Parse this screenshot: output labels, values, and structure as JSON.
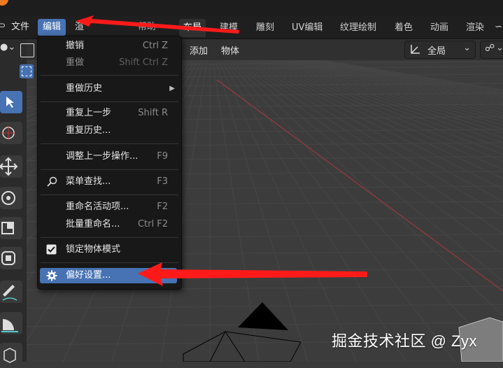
{
  "menubar": {
    "file": "文件",
    "edit": "编辑",
    "render_partial": "渲",
    "help_partial": "帮助"
  },
  "workspace_tabs": [
    "布局",
    "建模",
    "雕刻",
    "UV编辑",
    "纹理绘制",
    "着色",
    "动画",
    "渲染"
  ],
  "viewport_header": {
    "add": "添加",
    "object": "物体",
    "orientation": "全局"
  },
  "edit_menu": {
    "undo": {
      "label": "撤销",
      "shortcut": "Ctrl Z"
    },
    "redo": {
      "label": "重做",
      "shortcut": "Shift Ctrl Z"
    },
    "undo_history": {
      "label": "重做历史"
    },
    "repeat_last": {
      "label": "重复上一步",
      "shortcut": "Shift R"
    },
    "repeat_history": {
      "label": "重复历史..."
    },
    "adjust_last": {
      "label": "调整上一步操作...",
      "shortcut": "F9"
    },
    "menu_search": {
      "label": "菜单查找...",
      "shortcut": "F3"
    },
    "rename_active": {
      "label": "重命名活动项...",
      "shortcut": "F2"
    },
    "batch_rename": {
      "label": "批量重命名...",
      "shortcut": "Ctrl F2"
    },
    "lock_object_modes": {
      "label": "锁定物体模式",
      "checked": true
    },
    "preferences": {
      "label": "偏好设置..."
    }
  },
  "watermark": "掘金技术社区 @ Zyx",
  "colors": {
    "accent": "#4772b3",
    "arrow": "#ff1a1a",
    "x_axis": "#8a3b3b"
  }
}
